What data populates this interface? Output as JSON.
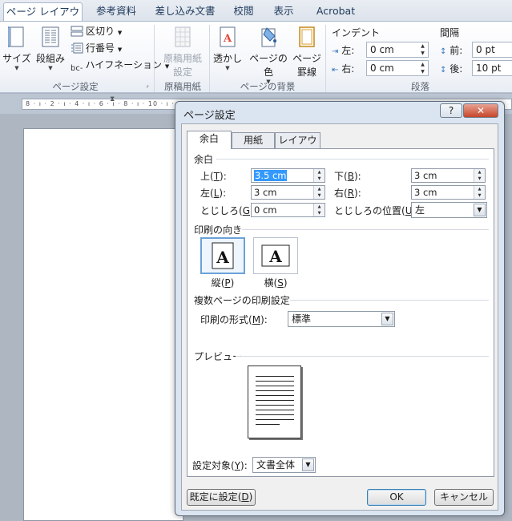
{
  "ribbon": {
    "tabs": [
      "ページ レイアウト",
      "参考資料",
      "差し込み文書",
      "校閲",
      "表示",
      "Acrobat"
    ],
    "active_tab": "ページ レイアウト",
    "page_setup": {
      "size": "サイズ",
      "columns": "段組み",
      "breaks": "区切り",
      "line_numbers": "行番号",
      "hyphenation": "ハイフネーション",
      "group_label": "ページ設定"
    },
    "manuscript": {
      "button_line1": "原稿用紙",
      "button_line2": "設定",
      "group_label": "原稿用紙"
    },
    "background": {
      "watermark": "透かし",
      "page_color": "ページの色",
      "borders_line1": "ページ",
      "borders_line2": "罫線",
      "group_label": "ページの背景"
    },
    "paragraph": {
      "indent_title": "インデント",
      "left_label": "左:",
      "left_value": "0 cm",
      "right_label": "右:",
      "right_value": "0 cm",
      "spacing_title": "間隔",
      "before_label": "前:",
      "before_value": "0 pt",
      "after_label": "後:",
      "after_value": "10 pt",
      "group_label": "段落"
    }
  },
  "ruler": {
    "text": "8 · ı · 2 · ı · 4 · ı · 6 · ı · 8 · ı · 10 · ı · 12 · ı · 14 · ı · 16 · ı · 18 · ı · 13"
  },
  "dialog": {
    "title": "ページ設定",
    "help_label": "?",
    "close_label": "✕",
    "tabs": [
      "余白",
      "用紙",
      "レイアウト"
    ],
    "active_tab": "余白",
    "margins": {
      "title": "余白",
      "top_label": "上",
      "top_key": "T",
      "top_value": "3.5 cm",
      "bottom_label": "下",
      "bottom_key": "B",
      "bottom_value": "3 cm",
      "left_label": "左",
      "left_key": "L",
      "left_value": "3 cm",
      "right_label": "右",
      "right_key": "R",
      "right_value": "3 cm",
      "gutter_label": "とじしろ",
      "gutter_key": "G",
      "gutter_value": "0 cm",
      "gutter_pos_label": "とじしろの位置",
      "gutter_pos_key": "U",
      "gutter_pos_value": "左"
    },
    "orientation": {
      "title": "印刷の向き",
      "portrait_label": "縦",
      "portrait_key": "P",
      "landscape_label": "横",
      "landscape_key": "S",
      "icon_letter": "A",
      "selected": "縦"
    },
    "multiple_pages": {
      "title": "複数ページの印刷設定",
      "label": "印刷の形式",
      "key": "M",
      "value": "標準"
    },
    "preview": {
      "title": "プレビュー"
    },
    "apply_to": {
      "label": "設定対象",
      "key": "Y",
      "value": "文書全体"
    },
    "buttons": {
      "default_label": "既定に設定",
      "default_key": "D",
      "ok": "OK",
      "cancel": "キャンセル"
    }
  }
}
